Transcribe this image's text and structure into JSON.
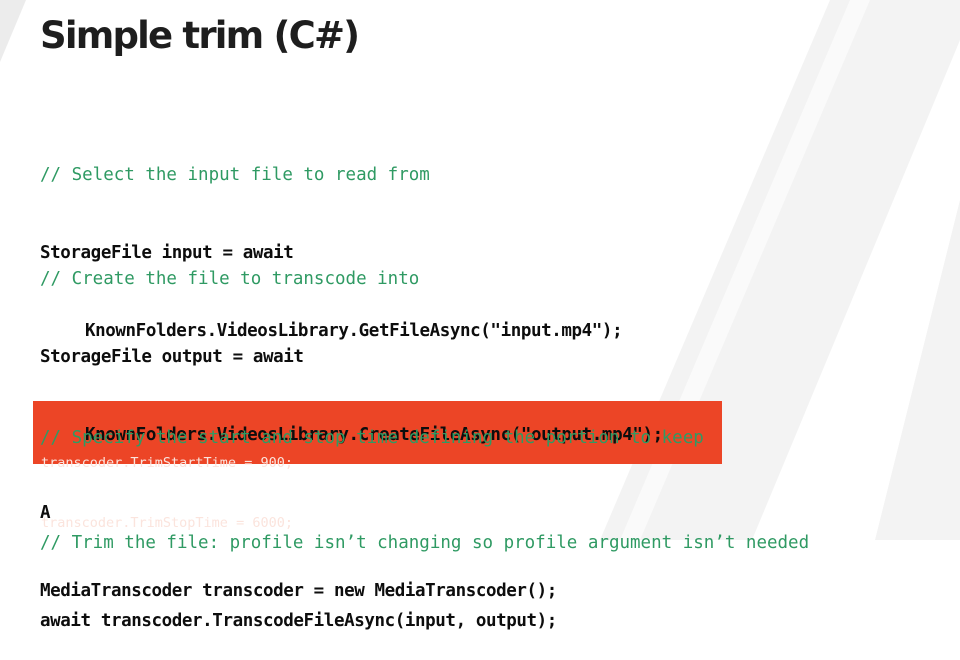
{
  "slide": {
    "title": "Simple trim (C#)",
    "highlight_color": "#ec4526",
    "comment_color": "#2f9a63"
  },
  "code": {
    "block1": {
      "comment": "// Select the input file to read from",
      "line1": "StorageFile input = await",
      "line2": "KnownFolders.VideosLibrary.GetFileAsync(\"input.mp4\");"
    },
    "block2": {
      "comment": "// Create the file to transcode into",
      "line1": "StorageFile output = await",
      "line2": "KnownFolders.VideosLibrary.CreateFileAsync(\"output.mp4\");",
      "line3": "A",
      "line4": "MediaTranscoder transcoder = new MediaTranscoder();"
    },
    "block3": {
      "comment": "// Specify the start and stop time defining the portion to keep",
      "highlight_line1": "transcoder.TrimStartTime = 900;",
      "highlight_line2": "transcoder.TrimStopTime = 6000;"
    },
    "block4": {
      "comment": "// Trim the file: profile isn’t changing so profile argument isn’t needed",
      "line1": "await transcoder.TranscodeFileAsync(input, output);"
    }
  }
}
